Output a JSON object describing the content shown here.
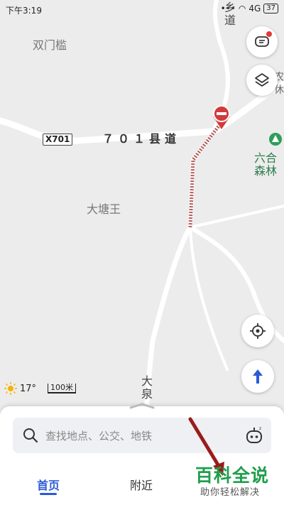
{
  "status_bar": {
    "time": "下午3:19",
    "signal": "4G",
    "battery": "37"
  },
  "map": {
    "labels": {
      "shuangmenkan": "双门槛",
      "datangwang": "大塘王",
      "road_701": "７０１县道",
      "road_badge": "X701",
      "top_road": "乡道",
      "bottom_road": "大泉",
      "park": "六合\n森林",
      "right_edge": "农\n休闲"
    }
  },
  "controls": {
    "feedback_icon": "message-icon",
    "layers_icon": "layers-icon",
    "locate_icon": "locate-icon",
    "navigate_icon": "navigate-arrow-icon"
  },
  "weather": {
    "temperature": "17°",
    "scale": "100米"
  },
  "search": {
    "placeholder": "查找地点、公交、地铁"
  },
  "tabs": [
    {
      "label": "首页",
      "active": true
    },
    {
      "label": "附近",
      "active": false
    }
  ],
  "watermark": {
    "title": "百科全说",
    "subtitle": "助你轻松解决"
  },
  "colors": {
    "accent": "#2a5bd7",
    "route_closed": "#b55a5a",
    "park_green": "#2e7d4f"
  }
}
